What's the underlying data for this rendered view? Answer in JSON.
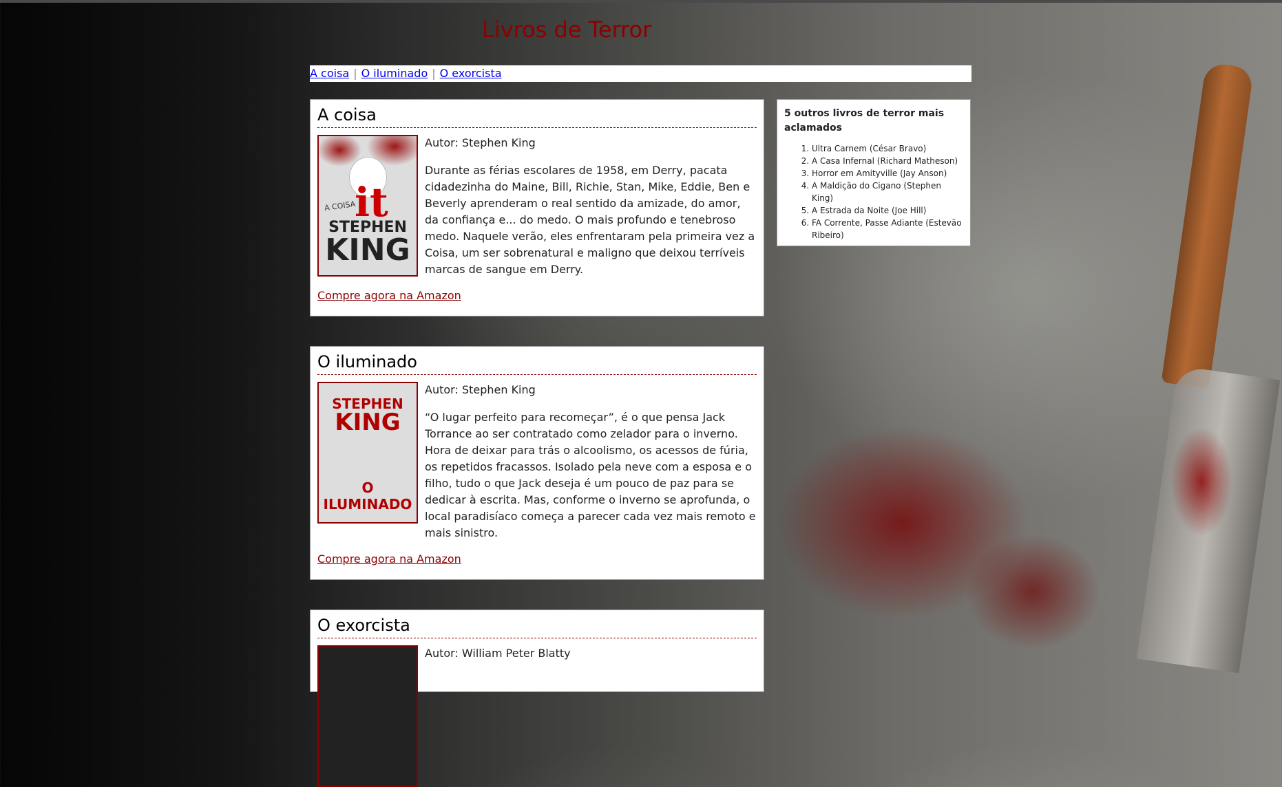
{
  "site": {
    "title": "Livros de Terror"
  },
  "nav": {
    "items": [
      {
        "label": "A coisa"
      },
      {
        "label": "O iluminado"
      },
      {
        "label": "O exorcista"
      }
    ]
  },
  "articles": [
    {
      "title": "A coisa",
      "author": "Autor: Stephen King",
      "description": "Durante as férias escolares de 1958, em Derry, pacata cidadezinha do Maine, Bill, Richie, Stan, Mike, Eddie, Ben e Beverly aprenderam o real sentido da amizade, do amor, da confiança e... do medo. O mais profundo e tenebroso medo. Naquele verão, eles enfrentaram pela primeira vez a Coisa, um ser sobrenatural e maligno que deixou terríveis marcas de sangue em Derry.",
      "buy_label": "Compre agora na Amazon",
      "cover": {
        "word": "it",
        "sub": "A COISA",
        "author_top": "STEPHEN",
        "author_bottom": "KING"
      }
    },
    {
      "title": "O iluminado",
      "author": "Autor: Stephen King",
      "description": "“O lugar perfeito para recomeçar”, é o que pensa Jack Torrance ao ser contratado como zelador para o inverno. Hora de deixar para trás o alcoolismo, os acessos de fúria, os repetidos fracassos. Isolado pela neve com a esposa e o filho, tudo o que Jack deseja é um pouco de paz para se dedicar à escrita. Mas, conforme o inverno se aprofunda, o local paradisíaco começa a parecer cada vez mais remoto e mais sinistro.",
      "buy_label": "Compre agora na Amazon",
      "cover": {
        "author_top": "STEPHEN",
        "author_bottom": "KING",
        "word": "O ILUMINADO"
      }
    },
    {
      "title": "O exorcista",
      "author": "Autor: William Peter Blatty"
    }
  ],
  "sidebar": {
    "title": "5 outros livros de terror mais aclamados",
    "items": [
      "Ultra Carnem (César Bravo)",
      "A Casa Infernal (Richard Matheson)",
      "Horror em Amityville (Jay Anson)",
      "A Maldição do Cigano (Stephen King)",
      "A Estrada da Noite (Joe Hill)",
      "FA Corrente, Passe Adiante (Estevão Ribeiro)"
    ]
  }
}
